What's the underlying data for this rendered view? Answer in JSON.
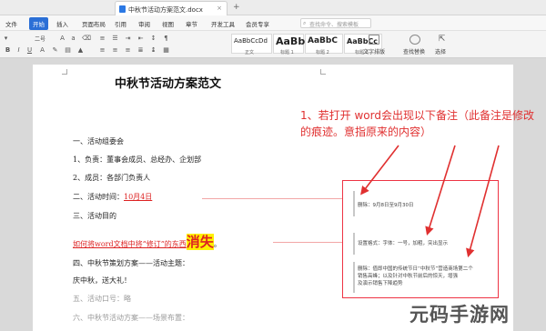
{
  "tab": {
    "filename": "中秋节活动方案范文.docx",
    "close": "×",
    "add": "+"
  },
  "menu": {
    "items": [
      {
        "label": "文件",
        "active": false
      },
      {
        "label": "开始",
        "active": true
      },
      {
        "label": "插入",
        "active": false
      },
      {
        "label": "页面布局",
        "active": false
      },
      {
        "label": "引用",
        "active": false
      },
      {
        "label": "审阅",
        "active": false
      },
      {
        "label": "视图",
        "active": false
      },
      {
        "label": "章节",
        "active": false
      },
      {
        "label": "开发工具",
        "active": false
      },
      {
        "label": "会员专享",
        "active": false
      }
    ],
    "search_placeholder": "查找命令、搜索模板"
  },
  "ribbon": {
    "font_size": "二号",
    "styles": [
      {
        "sample": "AaBbCcDd",
        "label": "正文"
      },
      {
        "sample": "AaBb",
        "label": "标题 1"
      },
      {
        "sample": "AaBbC",
        "label": "标题 2"
      },
      {
        "sample": "AaBbCc",
        "label": "标题 3"
      }
    ],
    "text_tools": "文字排版",
    "find_replace": "查找替换",
    "select": "选择"
  },
  "document": {
    "title": "中秋节活动方案范文",
    "lines": [
      {
        "text": "一、活动组委会"
      },
      {
        "text": "1、负责：董事会成员、总经办、企划部"
      },
      {
        "text": "2、成员：各部门负责人"
      },
      {
        "text_before": "二、活动时间：",
        "date": "10月4日"
      },
      {
        "text": "三、活动目的"
      },
      {
        "red_text": "如何将word文档中将“修订”的东西",
        "highlight": "消失",
        "tail": "。"
      },
      {
        "text": "四、中秋节策划方案——活动主题："
      },
      {
        "text": "庆中秋，送大礼！"
      },
      {
        "text": "五、活动口号：略"
      },
      {
        "text": "六、中秋节活动方案——场景布置："
      }
    ]
  },
  "annotation": "1、若打开 word会出现以下备注（此备注是修改的痕迹。意指原来的内容）",
  "comments": [
    {
      "lines": [
        "删除：9月8日至9月30日"
      ]
    },
    {
      "lines": [
        "设置格式：字体：一号，加粗，突出显示"
      ]
    },
    {
      "lines": [
        "删除：值即中国的传统节日“中秋节”营造商场第二个",
        "销售高峰；以及针对中秋节前后的惊天，增强",
        "及演示销售下降趋势"
      ]
    }
  ],
  "watermark": "元码手游网",
  "colors": {
    "accent": "#2b6fd6",
    "annotation": "#e03030",
    "highlight": "#ffef00"
  }
}
